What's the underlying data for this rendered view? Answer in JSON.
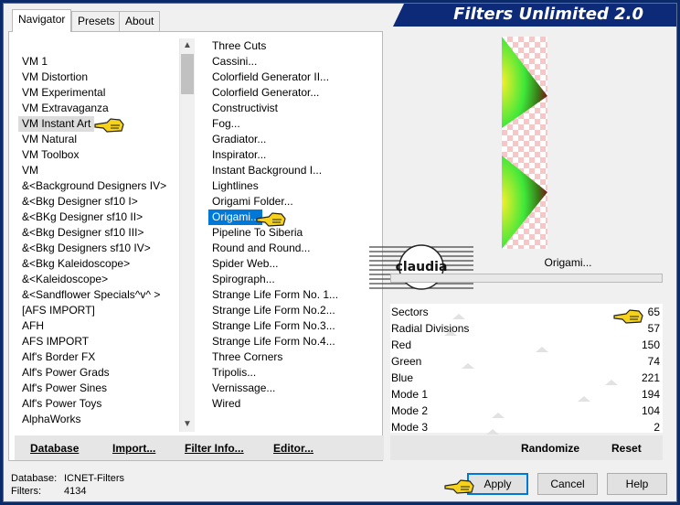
{
  "window": {
    "title": "Filters Unlimited 2.0"
  },
  "tabs": [
    {
      "label": "Navigator"
    },
    {
      "label": "Presets"
    },
    {
      "label": "About"
    }
  ],
  "categories": [
    "VM 1",
    "VM Distortion",
    "VM Experimental",
    "VM Extravaganza",
    "VM Instant Art",
    "VM Natural",
    "VM Toolbox",
    "VM",
    "&<Background Designers IV>",
    "&<Bkg Designer sf10 I>",
    "&<BKg Designer sf10 II>",
    "&<Bkg Designer sf10 III>",
    "&<Bkg Designers sf10 IV>",
    "&<Bkg Kaleidoscope>",
    "&<Kaleidoscope>",
    "&<Sandflower Specials^v^ >",
    "[AFS IMPORT]",
    "AFH",
    "AFS IMPORT",
    "Alf's Border FX",
    "Alf's Power Grads",
    "Alf's Power Sines",
    "Alf's Power Toys",
    "AlphaWorks"
  ],
  "selected_category": "VM Instant Art",
  "filters": [
    "Three Cuts",
    "Cassini...",
    "Colorfield Generator II...",
    "Colorfield Generator...",
    "Constructivist",
    "Fog...",
    "Gradiator...",
    "Inspirator...",
    "Instant Background I...",
    "Lightlines",
    "Origami Folder...",
    "Origami...",
    "Pipeline To Siberia",
    "Round and Round...",
    "Spider Web...",
    "Spirograph...",
    "Strange Life Form No. 1...",
    "Strange Life Form No.2...",
    "Strange Life Form No.3...",
    "Strange Life Form No.4...",
    "Three Corners",
    "Tripolis...",
    "Vernissage...",
    "Wired"
  ],
  "selected_filter": "Origami...",
  "preview": {
    "filter_name": "Origami...",
    "watermark_text": "claudia"
  },
  "params": [
    {
      "label": "Sectors",
      "value": "65",
      "level": 0.25
    },
    {
      "label": "Radial Divisions",
      "value": "57",
      "level": 0.22
    },
    {
      "label": "Red",
      "value": "150",
      "level": 0.59
    },
    {
      "label": "Green",
      "value": "74",
      "level": 0.29
    },
    {
      "label": "Blue",
      "value": "221",
      "level": 0.87
    },
    {
      "label": "Mode 1",
      "value": "194",
      "level": 0.76
    },
    {
      "label": "Mode 2",
      "value": "104",
      "level": 0.41
    },
    {
      "label": "Mode 3",
      "value": "2",
      "level": 0.39
    }
  ],
  "bottom_left_buttons": {
    "database": "Database",
    "import": "Import...",
    "filter_info": "Filter Info...",
    "editor": "Editor..."
  },
  "right_buttons": {
    "randomize": "Randomize",
    "reset": "Reset"
  },
  "status": {
    "database_label": "Database:",
    "database_value": "ICNET-Filters",
    "filters_label": "Filters:",
    "filters_value": "4134"
  },
  "dialog_buttons": {
    "apply": "Apply",
    "cancel": "Cancel",
    "help": "Help"
  },
  "colors": {
    "accent": "#0078d7",
    "title_bar": "#0d2a78",
    "frame": "#0a2a6a"
  }
}
